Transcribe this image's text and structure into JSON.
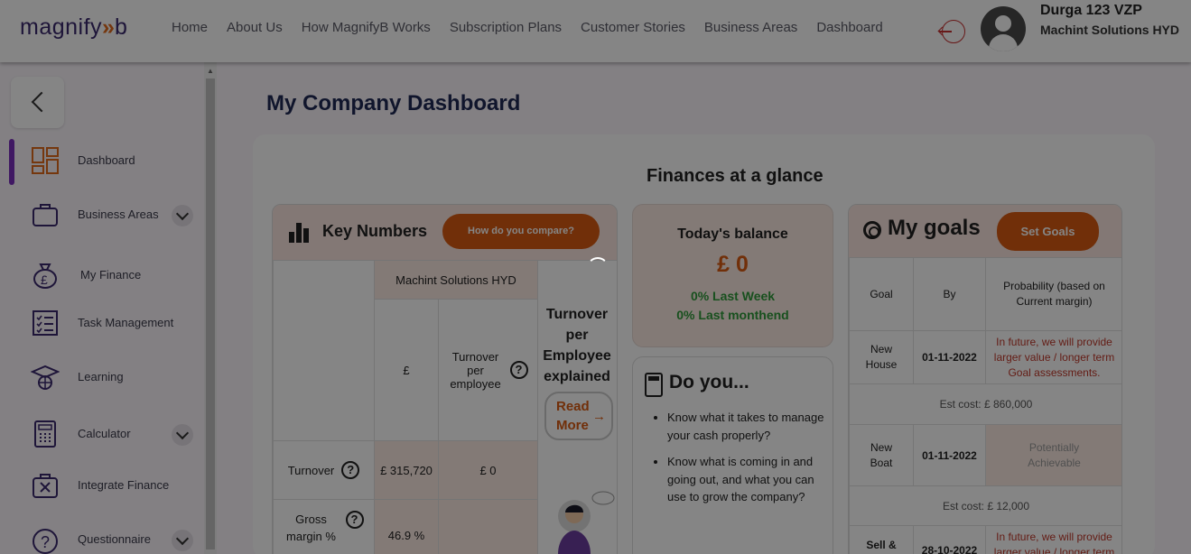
{
  "header": {
    "logo_text": "magnify",
    "logo_arrows": "»",
    "logo_end": "b",
    "nav": [
      "Home",
      "About Us",
      "How MagnifyB Works",
      "Subscription Plans",
      "Customer Stories",
      "Business Areas",
      "Dashboard"
    ],
    "user_name": "Durga 123 VZP",
    "user_company": "Machint Solutions HYD"
  },
  "sidebar": {
    "items": [
      {
        "label": "Dashboard"
      },
      {
        "label": "Business Areas"
      },
      {
        "label": "My Finance"
      },
      {
        "label": "Task Management"
      },
      {
        "label": "Learning"
      },
      {
        "label": "Calculator"
      },
      {
        "label": "Integrate Finance"
      },
      {
        "label": "Questionnaire"
      }
    ]
  },
  "page": {
    "title": "My Company Dashboard",
    "section_title": "Finances at a glance"
  },
  "key_numbers": {
    "title": "Key Numbers",
    "compare_button": "How do you compare?",
    "company_header": "Machint Solutions HYD",
    "col_currency": "£",
    "col_turnover_per_employee": "Turnover per employee",
    "side_title": "Turnover per Employee explained",
    "read_more": "Read More",
    "rows": [
      {
        "label": "Turnover",
        "value": "£ 315,720",
        "per_employee": "£ 0"
      },
      {
        "label": "Gross margin %",
        "value": "46.9 %",
        "per_employee": ""
      }
    ]
  },
  "balance": {
    "title": "Today's balance",
    "value": "£ 0",
    "last_week": "0% Last Week",
    "last_monthend": "0% Last monthend"
  },
  "do_you": {
    "title": "Do you...",
    "items": [
      "Know what it takes to manage your cash properly?",
      "Know what is coming in and going out, and what you can use to grow the company?"
    ]
  },
  "goals": {
    "title": "My goals",
    "set_button": "Set Goals",
    "headers": {
      "goal": "Goal",
      "by": "By",
      "probability": "Probability (based on Current margin)"
    },
    "rows": [
      {
        "goal": "New House",
        "by": "01-11-2022",
        "probability": "In future, we will provide larger value / longer term Goal assessments.",
        "est": "Est cost: £ 860,000"
      },
      {
        "goal": "New Boat",
        "by": "01-11-2022",
        "probability": "Potentially Achievable",
        "est": "Est cost: £ 12,000"
      },
      {
        "goal": "Sell &",
        "by": "28-10-2022",
        "probability": "In future, we will provide larger value / longer term",
        "est": ""
      }
    ]
  }
}
